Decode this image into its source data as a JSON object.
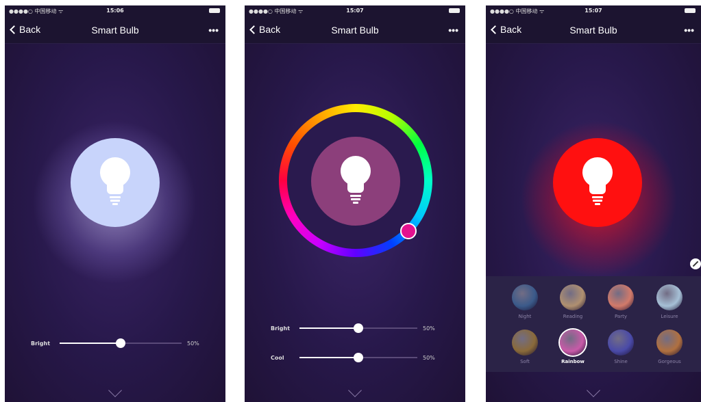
{
  "screens": [
    {
      "status": {
        "carrier": "●●●●○ 中国移动 ᯤ",
        "time": "15:06"
      },
      "nav": {
        "back_label": "Back",
        "title": "Smart Bulb",
        "more_label": "•••"
      },
      "sliders": [
        {
          "label": "Bright",
          "value": "50%",
          "level": 0.5
        }
      ]
    },
    {
      "status": {
        "carrier": "●●●●○ 中国移动 ᯤ",
        "time": "15:07"
      },
      "nav": {
        "back_label": "Back",
        "title": "Smart Bulb",
        "more_label": "•••"
      },
      "sliders": [
        {
          "label": "Bright",
          "value": "50%",
          "level": 0.5
        },
        {
          "label": "Cool",
          "value": "50%",
          "level": 0.5
        }
      ]
    },
    {
      "status": {
        "carrier": "●●●●○ 中国移动 ᯤ",
        "time": "15:07"
      },
      "nav": {
        "back_label": "Back",
        "title": "Smart Bulb",
        "more_label": "•••"
      },
      "scenes": [
        {
          "label": "Night",
          "color": "#3b5a8a"
        },
        {
          "label": "Reading",
          "color": "#b09070"
        },
        {
          "label": "Party",
          "color": "#d27a6a"
        },
        {
          "label": "Leisure",
          "color": "#a6c0d6"
        },
        {
          "label": "Soft",
          "color": "#8a6a3a"
        },
        {
          "label": "Rainbow",
          "color": "#c85aa8"
        },
        {
          "label": "Shine",
          "color": "#4a4aa8"
        },
        {
          "label": "Gorgeous",
          "color": "#b07040"
        }
      ],
      "active_scene": "Rainbow"
    }
  ],
  "colors": {
    "bulb_white": "#c8d4fb",
    "bulb_pink": "#8c3f7b",
    "bulb_red": "#ff1010",
    "wheel_handle": "#e4128f"
  }
}
